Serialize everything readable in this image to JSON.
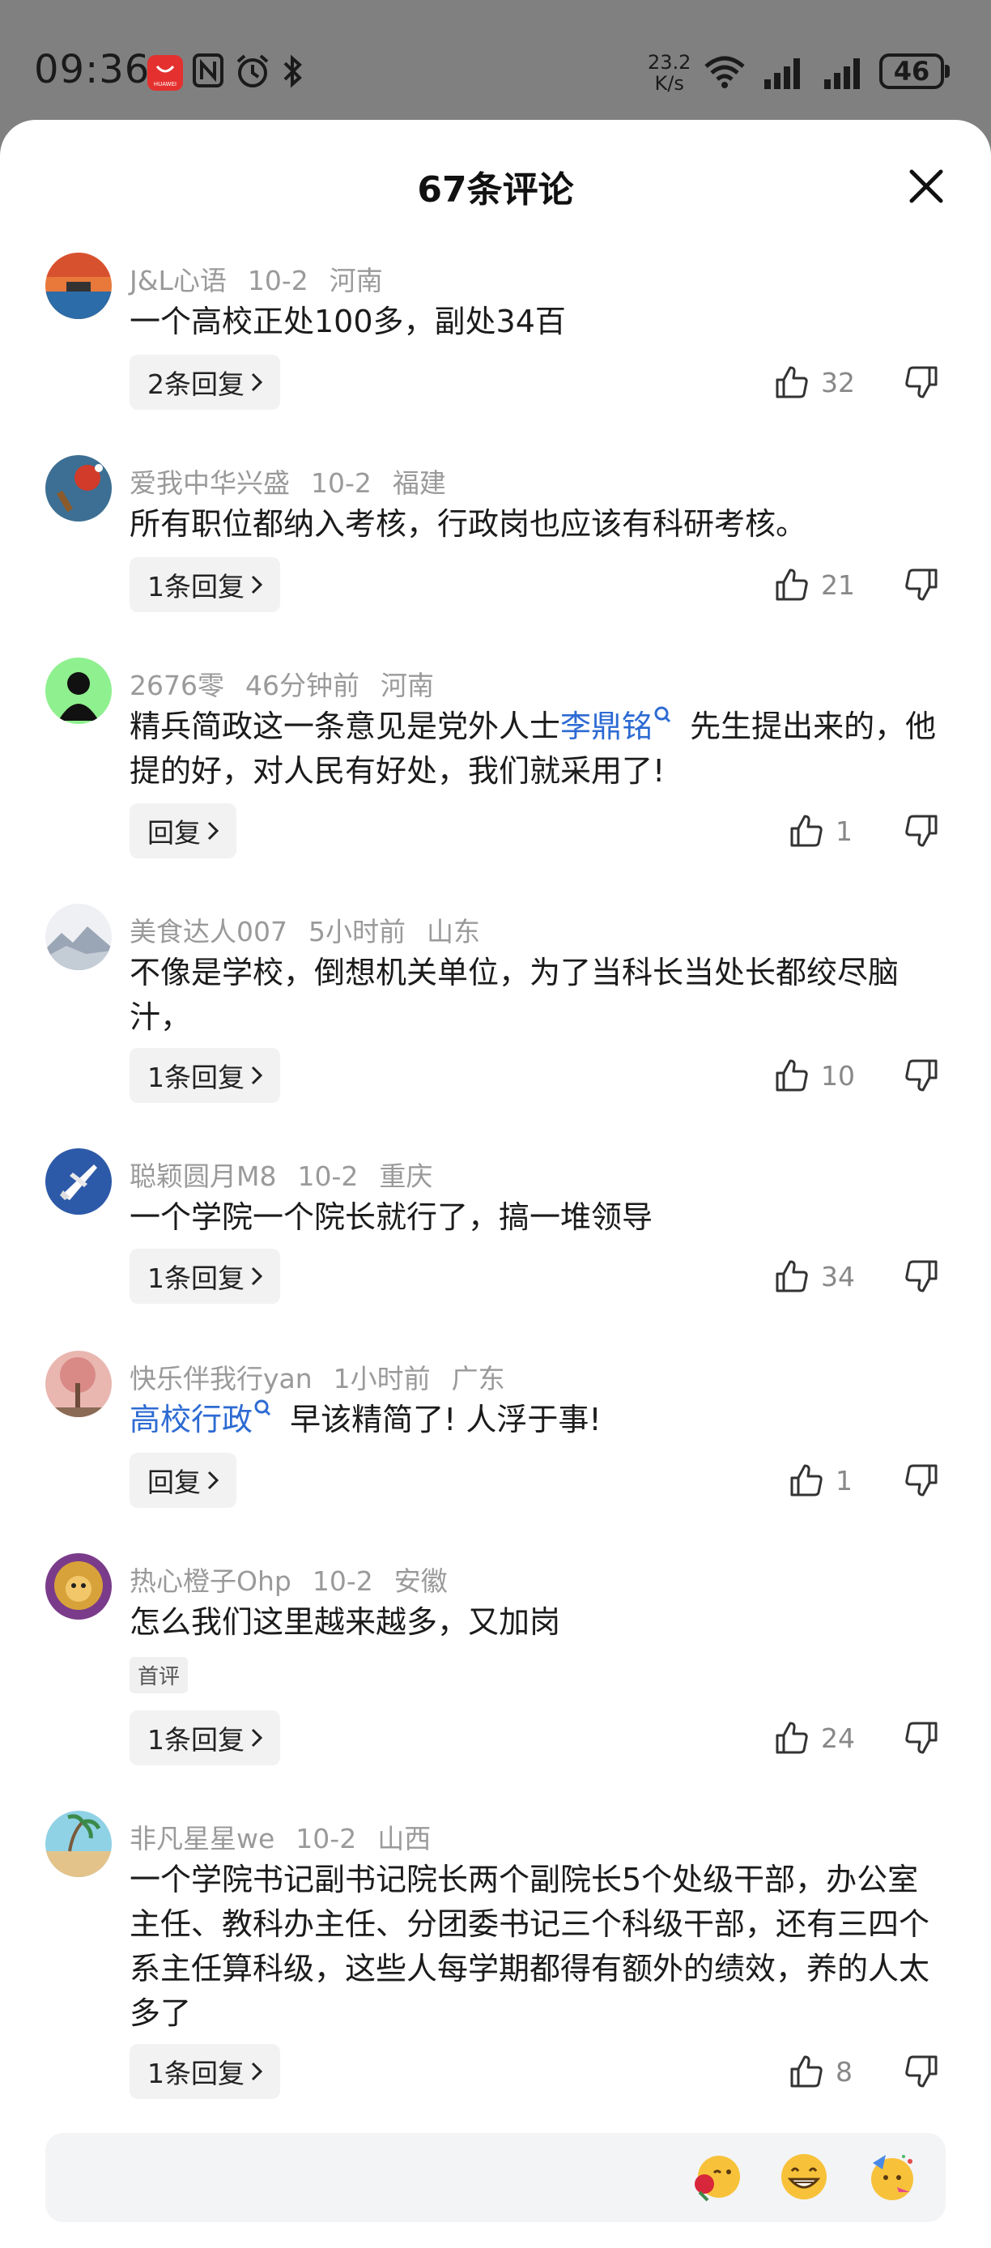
{
  "status_bar": {
    "time": "09:36",
    "net_rate_value": "23.2",
    "net_rate_unit": "K/s",
    "battery": "46",
    "brand_label": "HUAWEI",
    "icons": [
      "huawei-appgallery-icon",
      "nfc-icon",
      "alarm-icon",
      "bluetooth-icon",
      "wifi-icon",
      "signal-icon",
      "signal-icon",
      "battery-icon"
    ]
  },
  "sheet": {
    "title": "67条评论",
    "close_icon": "close-icon"
  },
  "comments": [
    {
      "user": "J&L心语",
      "time": "10-2",
      "location": "河南",
      "text": "一个高校正处100多，副处34百",
      "reply_label": "2条回复",
      "likes": "32",
      "avatar": {
        "kind": "sunset",
        "colors": [
          "#d8512f",
          "#2c6ca8"
        ]
      }
    },
    {
      "user": "爱我中华兴盛",
      "time": "10-2",
      "location": "福建",
      "text": "所有职位都纳入考核，行政岗也应该有科研考核。",
      "reply_label": "1条回复",
      "likes": "21",
      "avatar": {
        "kind": "pingpong",
        "colors": [
          "#3c6f93",
          "#d23b2a"
        ]
      }
    },
    {
      "user": "2676零",
      "time": "46分钟前",
      "location": "河南",
      "text_parts": [
        "精兵简政这一条意见是党外人士",
        "李鼎铭",
        " 先生提出来的，他提的好，对人民有好处，我们就采用了!"
      ],
      "reply_label": "回复",
      "likes": "1",
      "avatar": {
        "kind": "default",
        "colors": [
          "#8ef08e",
          "#111111"
        ]
      }
    },
    {
      "user": "美食达人007",
      "time": "5小时前",
      "location": "山东",
      "text": "不像是学校，倒想机关单位，为了当科长当处长都绞尽脑汁，",
      "reply_label": "1条回复",
      "likes": "10",
      "avatar": {
        "kind": "mountains",
        "colors": [
          "#eef0f3",
          "#9aa5b5"
        ]
      }
    },
    {
      "user": "聪颖圆月M8",
      "time": "10-2",
      "location": "重庆",
      "text": "一个学院一个院长就行了，搞一堆领导",
      "reply_label": "1条回复",
      "likes": "34",
      "avatar": {
        "kind": "jet",
        "colors": [
          "#2d5aa8",
          "#ffffff"
        ]
      }
    },
    {
      "user": "快乐伴我行yan",
      "time": "1小时前",
      "location": "广东",
      "text_parts": [
        "高校行政",
        " 早该精简了! 人浮于事!"
      ],
      "reply_label": "回复",
      "likes": "1",
      "avatar": {
        "kind": "tree",
        "colors": [
          "#d98a86",
          "#6e4b3a"
        ]
      }
    },
    {
      "user": "热心橙子Ohp",
      "time": "10-2",
      "location": "安徽",
      "text": "怎么我们这里越来越多，又加岗",
      "badge": "首评",
      "reply_label": "1条回复",
      "likes": "24",
      "avatar": {
        "kind": "lion",
        "colors": [
          "#d8a23a",
          "#7a3c8a"
        ]
      }
    },
    {
      "user": "非凡星星we",
      "time": "10-2",
      "location": "山西",
      "text": "一个学院书记副书记院长两个副院长5个处级干部，办公室主任、教科办主任、分团委书记三个科级干部，还有三四个系主任算科级，这些人每学期都得有额外的绩效，养的人太多了",
      "reply_label": "1条回复",
      "likes": "8",
      "avatar": {
        "kind": "beach",
        "colors": [
          "#8fd2e6",
          "#e4c38a"
        ]
      }
    }
  ],
  "input_bar": {
    "placeholder": "",
    "emojis": [
      "rose-kiss-emoji",
      "grin-emoji",
      "party-emoji"
    ]
  },
  "colors": {
    "link": "#2d6bd3",
    "meta_text": "#9a9a9a",
    "reply_bg": "#f2f2f2",
    "status_bg": "#808080"
  }
}
